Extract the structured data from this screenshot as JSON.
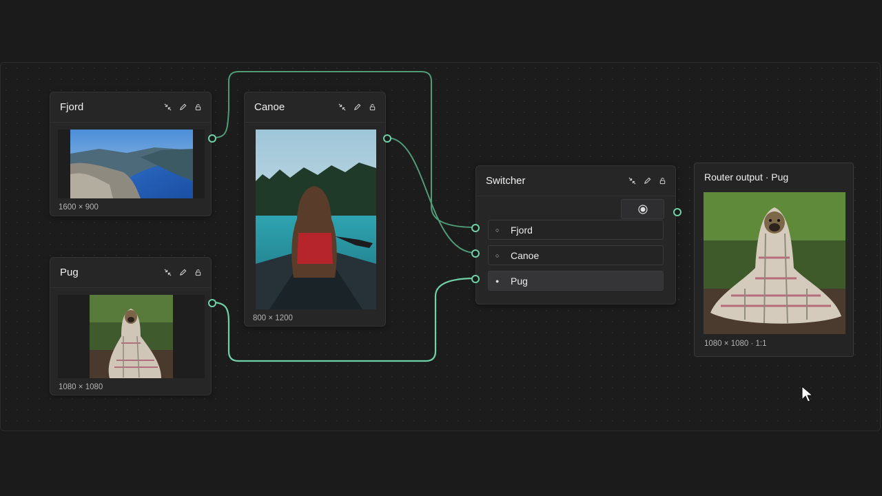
{
  "nodes": {
    "fjord": {
      "title": "Fjord",
      "meta": "1600 × 900"
    },
    "pug": {
      "title": "Pug",
      "meta": "1080 × 1080"
    },
    "canoe": {
      "title": "Canoe",
      "meta": "800 × 1200"
    },
    "switcher": {
      "title": "Switcher",
      "options": [
        {
          "radio": "○",
          "label": "Fjord"
        },
        {
          "radio": "○",
          "label": "Canoe"
        },
        {
          "radio": "●",
          "label": "Pug"
        }
      ]
    },
    "output": {
      "title": "Router output · Pug",
      "meta": "1080 × 1080 · 1:1"
    }
  },
  "icons": [
    "collapse-icon",
    "edit-pencil-icon",
    "lock-icon"
  ],
  "colors": {
    "wire": "#6fd3a8",
    "wire_dim": "#4f9c77",
    "background": "#1b1b1c",
    "node": "#262627"
  }
}
